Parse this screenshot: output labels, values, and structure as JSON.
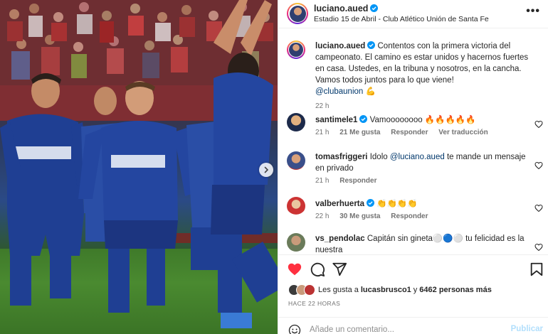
{
  "post": {
    "username": "luciano.aued",
    "location": "Estadio 15 de Abril - Club Atlético Unión de Santa Fe"
  },
  "caption": {
    "username": "luciano.aued",
    "text": "Contentos con la primera victoria del campeonato. El camino es estar unidos y hacernos fuertes en casa. Ustedes, en la tribuna y nosotros, en la cancha. Vamos todos juntos para lo que viene!",
    "mention": "@clubaunion",
    "emoji": "💪",
    "time": "22 h"
  },
  "comments": [
    {
      "username": "santimele1",
      "verified": true,
      "text": "Vamoooooooo",
      "emoji": "🔥🔥🔥🔥🔥",
      "time": "21 h",
      "likes": "21 Me gusta",
      "reply_label": "Responder",
      "translate_label": "Ver traducción"
    },
    {
      "username": "tomasfriggeri",
      "text_before": "Idolo",
      "mention": "@luciano.aued",
      "text_after": "te mande un mensaje en privado",
      "time": "21 h",
      "reply_label": "Responder"
    },
    {
      "username": "valberhuerta",
      "verified": true,
      "emoji": "👏👏👏👏",
      "time": "22 h",
      "likes": "30 Me gusta",
      "reply_label": "Responder"
    },
    {
      "username": "vs_pendolac",
      "text": "Capitán sin gineta⚪🔵⚪ tu felicidad es la nuestra"
    }
  ],
  "likes_summary": {
    "prefix": "Les gusta a",
    "user": "lucasbrusco1",
    "connector": "y",
    "others": "6462 personas más"
  },
  "posted_date": "HACE 22 HORAS",
  "add_comment": {
    "placeholder": "Añade un comentario...",
    "publish_label": "Publicar"
  },
  "colors": {
    "like_red": "#ff3040",
    "verified_blue": "#0095f6",
    "mention_blue": "#00376b",
    "publish_disabled": "#b2dffc",
    "jersey_blue": "#1f3f93"
  },
  "icons": [
    "verified-badge-icon",
    "more-options-icon",
    "heart-icon",
    "comment-icon",
    "share-icon",
    "bookmark-icon",
    "emoji-icon",
    "chevron-right-icon"
  ]
}
